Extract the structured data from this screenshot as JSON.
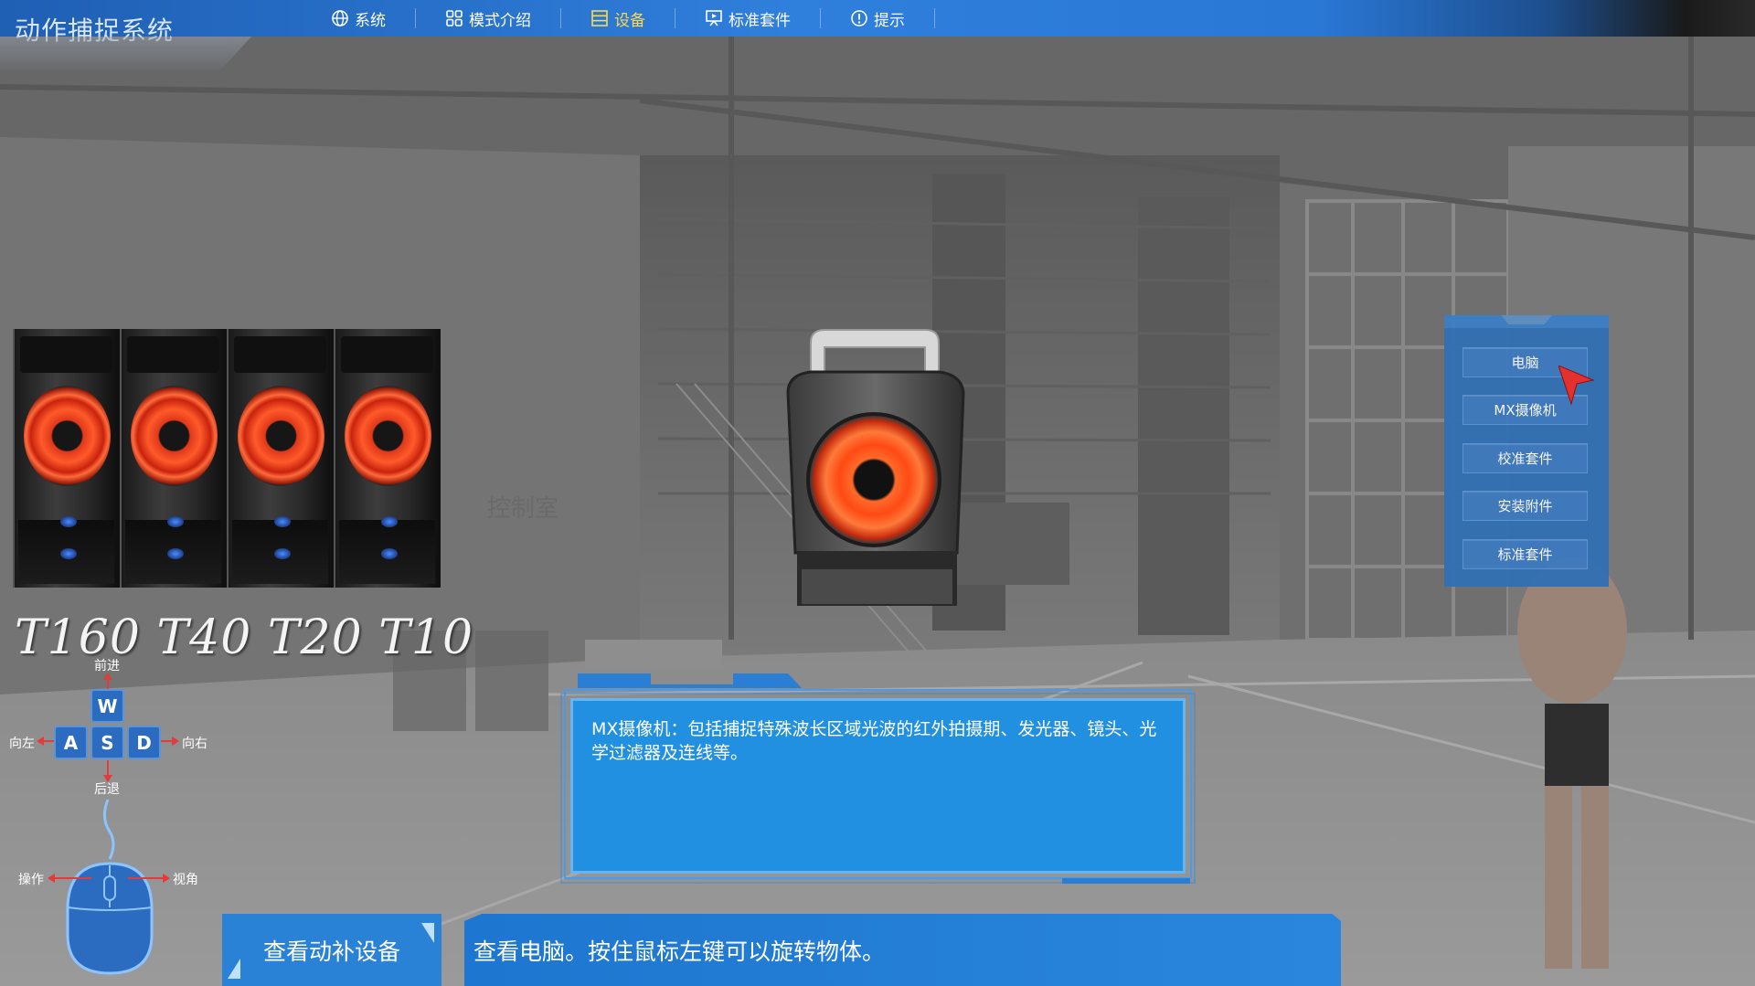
{
  "app": {
    "title": "动作捕捉系统"
  },
  "nav": [
    {
      "label": "系统",
      "icon": "globe-icon"
    },
    {
      "label": "模式介绍",
      "icon": "grid-icon"
    },
    {
      "label": "设备",
      "icon": "list-icon",
      "active": true
    },
    {
      "label": "标准套件",
      "icon": "presentation-icon"
    },
    {
      "label": "提示",
      "icon": "info-icon"
    }
  ],
  "products": {
    "label": "T160 T40 T20 T10"
  },
  "device_menu": {
    "items": [
      "电脑",
      "MX摄像机",
      "校准套件",
      "安装附件",
      "标准套件"
    ]
  },
  "controls": {
    "forward": "前进",
    "back": "后退",
    "left": "向左",
    "right": "向右",
    "keys": {
      "w": "W",
      "a": "A",
      "s": "S",
      "d": "D"
    },
    "operate": "操作",
    "view": "视角"
  },
  "description": {
    "text": "MX摄像机：包括捕捉特殊波长区域光波的红外拍摄期、发光器、镜头、光学过滤器及连线等。"
  },
  "bottom": {
    "left_label": "查看动补设备",
    "instruction": "查看电脑。按住鼠标左键可以旋转物体。"
  },
  "colors": {
    "accent_blue": "#2a82d6",
    "active_nav": "#ffd84d",
    "arrow_red": "#e23b3b"
  }
}
